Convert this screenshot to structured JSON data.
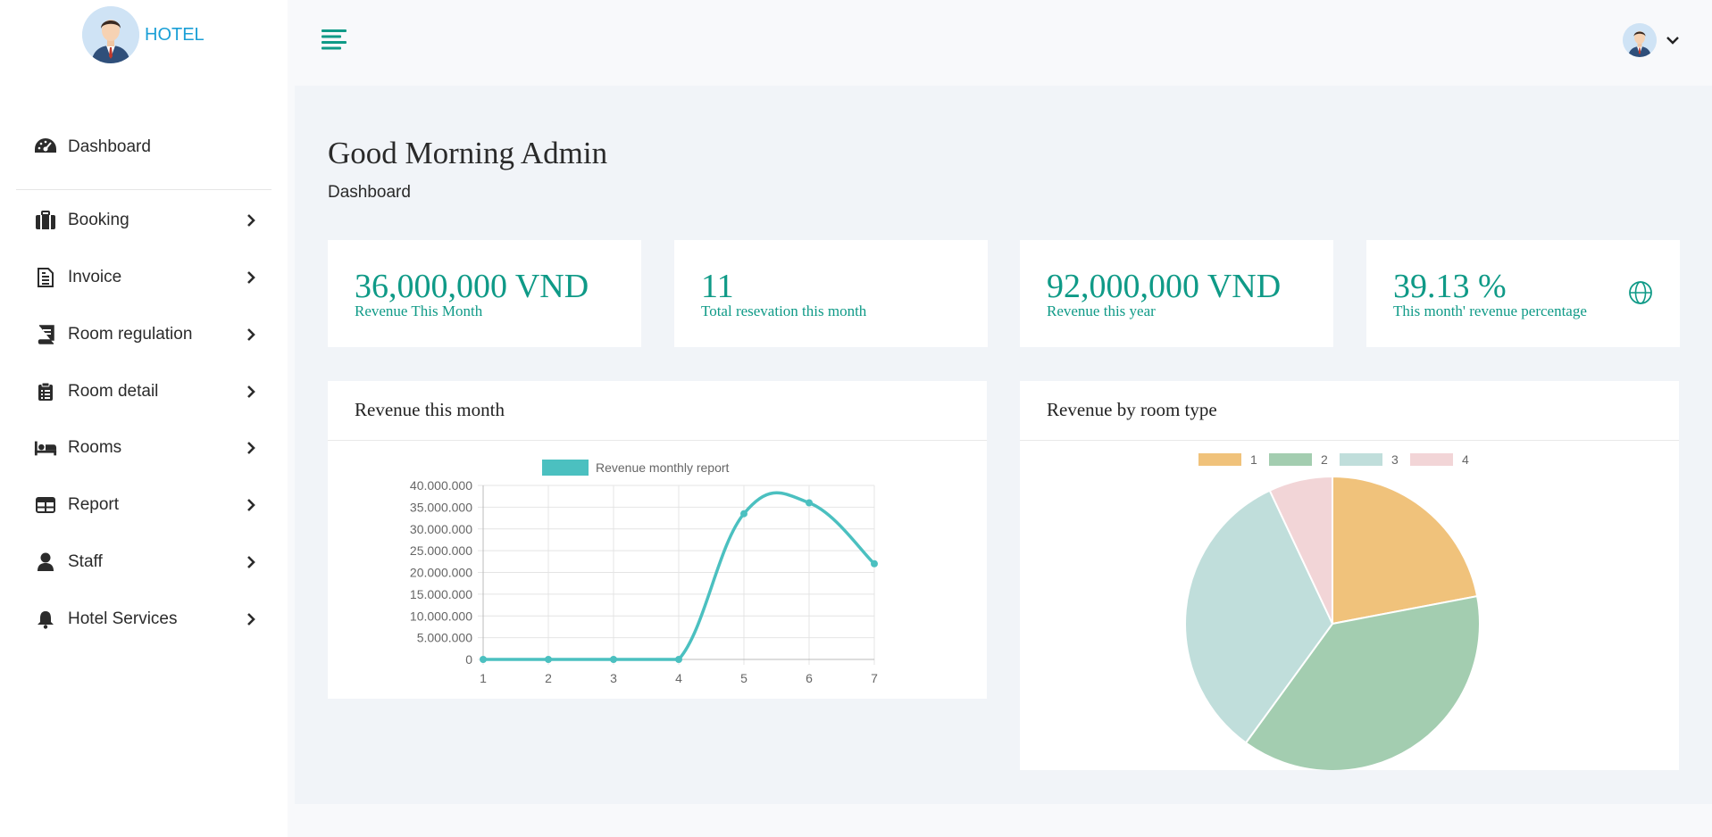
{
  "brand": {
    "name": "HOTEL"
  },
  "sidebar": {
    "items": [
      {
        "label": "Dashboard",
        "icon": "dashboard-icon",
        "has_submenu": false
      },
      {
        "label": "Booking",
        "icon": "suitcase-icon",
        "has_submenu": true
      },
      {
        "label": "Invoice",
        "icon": "invoice-icon",
        "has_submenu": true
      },
      {
        "label": "Room regulation",
        "icon": "book-icon",
        "has_submenu": true
      },
      {
        "label": "Room detail",
        "icon": "clipboard-icon",
        "has_submenu": true
      },
      {
        "label": "Rooms",
        "icon": "bed-icon",
        "has_submenu": true
      },
      {
        "label": "Report",
        "icon": "table-icon",
        "has_submenu": true
      },
      {
        "label": "Staff",
        "icon": "user-icon",
        "has_submenu": true
      },
      {
        "label": "Hotel Services",
        "icon": "bell-icon",
        "has_submenu": true
      }
    ]
  },
  "header": {
    "greeting": "Good Morning Admin",
    "breadcrumb": "Dashboard"
  },
  "stats": [
    {
      "value": "36,000,000 VND",
      "label": "Revenue This Month"
    },
    {
      "value": "11",
      "label": "Total resevation this month"
    },
    {
      "value": "92,000,000 VND",
      "label": "Revenue this year"
    },
    {
      "value": "39.13 %",
      "label": "This month' revenue percentage",
      "icon": "globe-icon"
    }
  ],
  "colors": {
    "accent": "#0f9a87",
    "line": "#4bc0c0",
    "pie": [
      "#f0c27b",
      "#a3cdb0",
      "#c0dedb",
      "#f2d5d7"
    ]
  },
  "charts": {
    "line_title": "Revenue this month",
    "pie_title": "Revenue by room type"
  },
  "chart_data": [
    {
      "type": "line",
      "series": [
        {
          "name": "Revenue monthly report",
          "values": [
            0,
            0,
            0,
            0,
            33500000,
            36000000,
            22000000
          ]
        }
      ],
      "x": [
        "1",
        "2",
        "3",
        "4",
        "5",
        "6",
        "7"
      ],
      "ylim": [
        0,
        40000000
      ],
      "yticks": [
        "40.000.000",
        "35.000.000",
        "30.000.000",
        "25.000.000",
        "20.000.000",
        "15.000.000",
        "10.000.000",
        "5.000.000",
        "0"
      ],
      "legend": "top",
      "grid": true
    },
    {
      "type": "pie",
      "categories": [
        "1",
        "2",
        "3",
        "4"
      ],
      "values": [
        22,
        38,
        33,
        7
      ],
      "legend": "top"
    }
  ]
}
